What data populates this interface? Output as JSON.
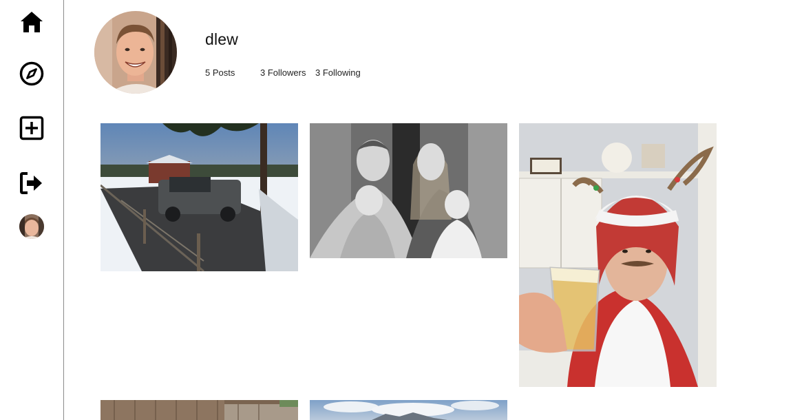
{
  "sidebar": {
    "items": [
      {
        "name": "home",
        "icon": "home-icon"
      },
      {
        "name": "explore",
        "icon": "compass-icon"
      },
      {
        "name": "create",
        "icon": "plus-square-icon"
      },
      {
        "name": "logout",
        "icon": "logout-icon"
      },
      {
        "name": "profile",
        "icon": "avatar"
      }
    ]
  },
  "profile": {
    "username": "dlew",
    "posts": "5 Posts",
    "followers": "3 Followers",
    "following": "3 Following"
  },
  "posts": [
    {
      "kind": "snowy-truck-photo"
    },
    {
      "kind": "family-bw-photo"
    },
    {
      "kind": "holiday-selfie-photo"
    },
    {
      "kind": "fence-photo"
    },
    {
      "kind": "sky-photo"
    }
  ],
  "colors": {
    "sidebar_border": "#8a8a8a",
    "text": "#111111"
  }
}
